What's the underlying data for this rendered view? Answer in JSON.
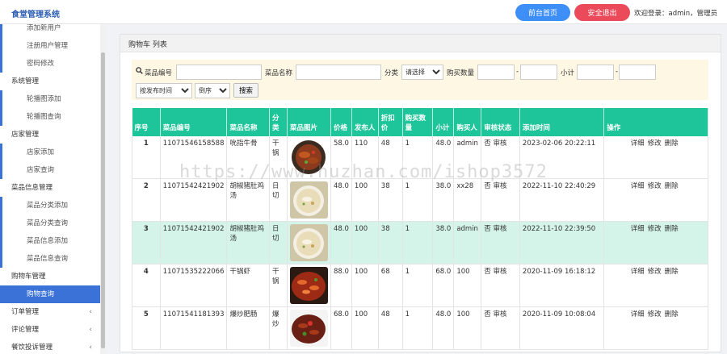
{
  "header": {
    "brand": "食堂管理系统",
    "home_btn": "前台首页",
    "logout_btn": "安全退出",
    "welcome": "欢迎登录：admin，管理员"
  },
  "sidebar": [
    {
      "label": "添加新用户",
      "type": "sub"
    },
    {
      "label": "注册用户管理",
      "type": "sub"
    },
    {
      "label": "密码修改",
      "type": "sub"
    },
    {
      "label": "系统管理",
      "type": "group"
    },
    {
      "label": "轮播图添加",
      "type": "sub"
    },
    {
      "label": "轮播图查询",
      "type": "sub"
    },
    {
      "label": "店家管理",
      "type": "group"
    },
    {
      "label": "店家添加",
      "type": "sub"
    },
    {
      "label": "店家查询",
      "type": "sub"
    },
    {
      "label": "菜品信息管理",
      "type": "group"
    },
    {
      "label": "菜品分类添加",
      "type": "sub"
    },
    {
      "label": "菜品分类查询",
      "type": "sub"
    },
    {
      "label": "菜品信息添加",
      "type": "sub"
    },
    {
      "label": "菜品信息查询",
      "type": "sub"
    },
    {
      "label": "购物车管理",
      "type": "group"
    },
    {
      "label": "购物查询",
      "type": "active"
    },
    {
      "label": "订单管理",
      "type": "group-collapsed"
    },
    {
      "label": "评论管理",
      "type": "group-collapsed"
    },
    {
      "label": "餐饮投诉管理",
      "type": "group-collapsed"
    }
  ],
  "panel": {
    "title": "购物车 列表"
  },
  "search": {
    "code_label": "菜品编号",
    "name_label": "菜品名称",
    "category_label": "分类",
    "category_value": "请选择",
    "qty_label": "购买数量",
    "subtotal_label": "小计",
    "dash": "-",
    "sort_field": "按发布时间",
    "sort_order": "倒序",
    "search_btn": "搜索"
  },
  "table": {
    "headers": [
      "序号",
      "菜品编号",
      "菜品名称",
      "分类",
      "菜品图片",
      "价格",
      "发布人",
      "折扣价",
      "购买数量",
      "小计",
      "购买人",
      "审核状态",
      "添加时间",
      "操作"
    ],
    "rows": [
      {
        "no": "1",
        "code": "11071546158588",
        "name": "吮指牛骨",
        "category": "干锅",
        "price": "58.0",
        "publisher": "110",
        "discount": "48",
        "qty": "1",
        "subtotal": "48.0",
        "buyer": "admin",
        "audit": "否 审核",
        "time": "2023-02-06 20:22:11"
      },
      {
        "no": "2",
        "code": "11071542421902",
        "name": "胡椒猪肚鸡汤",
        "category": "日切",
        "price": "48.0",
        "publisher": "100",
        "discount": "38",
        "qty": "1",
        "subtotal": "38.0",
        "buyer": "xx28",
        "audit": "否 审核",
        "time": "2022-11-10 22:40:29"
      },
      {
        "no": "3",
        "code": "11071542421902",
        "name": "胡椒猪肚鸡汤",
        "category": "日切",
        "price": "48.0",
        "publisher": "100",
        "discount": "38",
        "qty": "1",
        "subtotal": "38.0",
        "buyer": "admin",
        "audit": "否 审核",
        "time": "2022-11-10 22:39:50"
      },
      {
        "no": "4",
        "code": "11071535222066",
        "name": "干锅虾",
        "category": "干锅",
        "price": "88.0",
        "publisher": "100",
        "discount": "68",
        "qty": "1",
        "subtotal": "68.0",
        "buyer": "100",
        "audit": "否 审核",
        "time": "2020-11-09 16:18:12"
      },
      {
        "no": "5",
        "code": "11071541181393",
        "name": "爆炒肥肠",
        "category": "爆炒",
        "price": "68.0",
        "publisher": "100",
        "discount": "48",
        "qty": "1",
        "subtotal": "48.0",
        "buyer": "100",
        "audit": "否 审核",
        "time": "2020-11-09 10:08:04"
      }
    ],
    "ops": {
      "detail": "详细",
      "edit": "修改",
      "delete": "删除"
    }
  },
  "watermark": "https://www.huzhan.com/ishop3572",
  "colors": {
    "accent": "#3a72d8",
    "table_header": "#1fc59a",
    "highlight_row": "#d4f4e9",
    "home_btn": "#3e8ef7",
    "logout_btn": "#ea4a5a"
  }
}
